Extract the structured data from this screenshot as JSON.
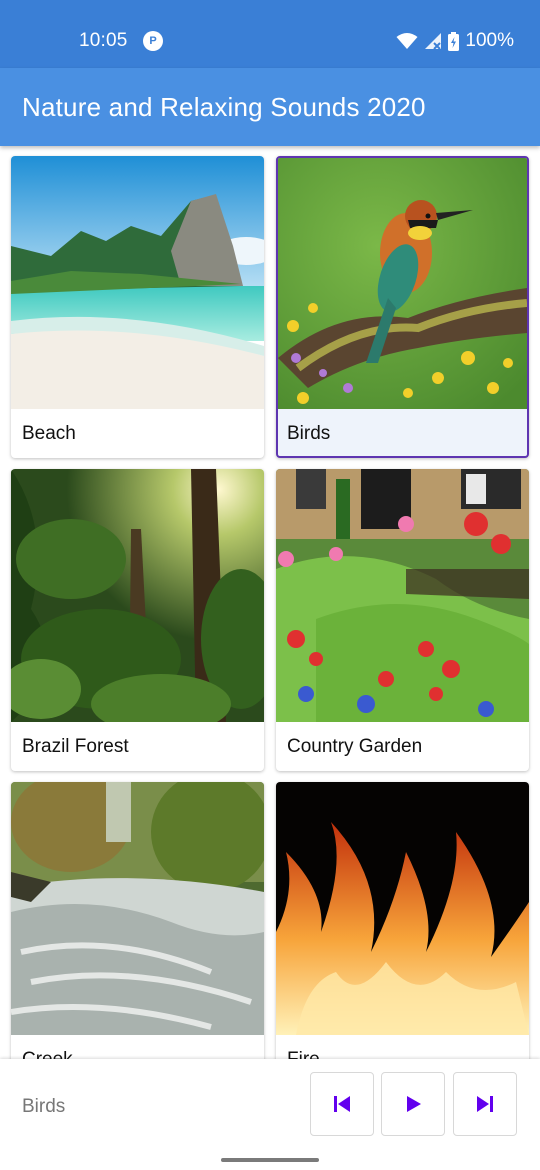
{
  "status_bar": {
    "time": "10:05",
    "battery": "100%"
  },
  "app_bar": {
    "title": "Nature and Relaxing Sounds 2020"
  },
  "grid": {
    "items": [
      {
        "label": "Beach",
        "selected": false
      },
      {
        "label": "Birds",
        "selected": true
      },
      {
        "label": "Brazil Forest",
        "selected": false
      },
      {
        "label": "Country Garden",
        "selected": false
      },
      {
        "label": "Creek",
        "selected": false
      },
      {
        "label": "Fire",
        "selected": false
      }
    ]
  },
  "player": {
    "now_playing": "Birds"
  },
  "colors": {
    "status_bar": "#3a7fd6",
    "app_bar": "#4a90e2",
    "accent": "#6200ee",
    "selected_border": "#5e35b1"
  },
  "icons": [
    "wifi-icon",
    "cellular-icon",
    "battery-icon",
    "skip-previous-icon",
    "play-icon",
    "skip-next-icon"
  ]
}
